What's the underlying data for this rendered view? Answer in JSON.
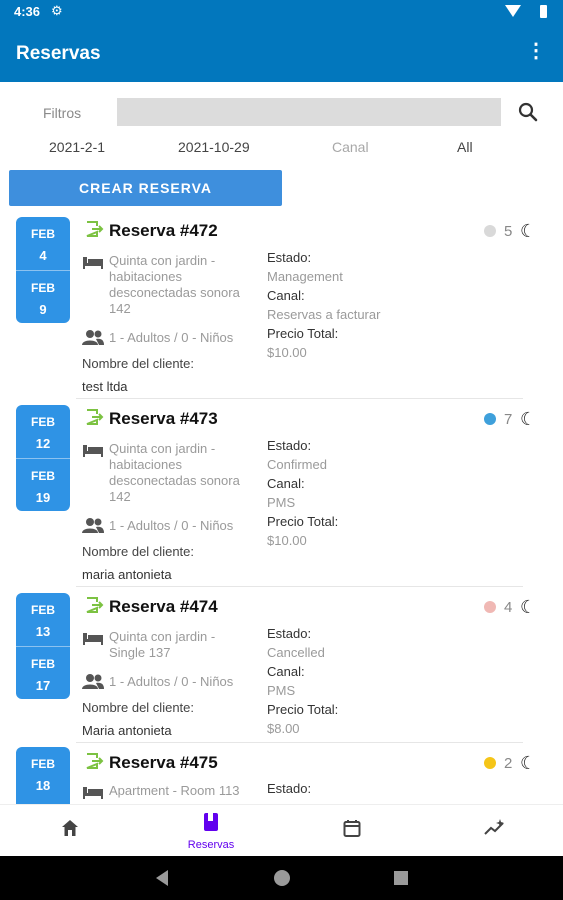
{
  "status_bar": {
    "time": "4:36"
  },
  "app_bar": {
    "title": "Reservas"
  },
  "filters": {
    "label": "Filtros",
    "search_value": "",
    "date_from": "2021-2-1",
    "date_to": "2021-10-29",
    "channel_placeholder": "Canal",
    "status": "All"
  },
  "create_button": "CREAR RESERVA",
  "labels": {
    "estado": "Estado:",
    "canal": "Canal:",
    "precio_total": "Precio Total:",
    "nombre_cliente": "Nombre del cliente:"
  },
  "reservations": [
    {
      "title": "Reserva #472",
      "checkin_month": "FEB",
      "checkin_day": "4",
      "checkout_month": "FEB",
      "checkout_day": "9",
      "room": "Quinta con jardin - habitaciones desconectadas sonora 142",
      "guests": "1 - Adultos / 0 - Niños",
      "client": "test ltda",
      "estado": "Management",
      "canal": "Reservas a facturar",
      "precio": "$10.00",
      "nights": "5",
      "status_color": "#d9d9d9"
    },
    {
      "title": "Reserva #473",
      "checkin_month": "FEB",
      "checkin_day": "12",
      "checkout_month": "FEB",
      "checkout_day": "19",
      "room": "Quinta con jardin - habitaciones desconectadas sonora 142",
      "guests": "1 - Adultos / 0 - Niños",
      "client": "maria antonieta",
      "estado": "Confirmed",
      "canal": "PMS",
      "precio": "$10.00",
      "nights": "7",
      "status_color": "#3ea0db"
    },
    {
      "title": "Reserva #474",
      "checkin_month": "FEB",
      "checkin_day": "13",
      "checkout_month": "FEB",
      "checkout_day": "17",
      "room": "Quinta con jardin - Single 137",
      "guests": "1 - Adultos / 0 - Niños",
      "client": "Maria antonieta",
      "estado": "Cancelled",
      "canal": "PMS",
      "precio": "$8.00",
      "nights": "4",
      "status_color": "#f0b8b4"
    },
    {
      "title": "Reserva #475",
      "checkin_month": "FEB",
      "checkin_day": "18",
      "room": "Apartment - Room 113",
      "nights": "2",
      "status_color": "#f5c518"
    }
  ],
  "bottom_nav": {
    "home_icon": "home-icon",
    "reservas_label": "Reservas",
    "calendar_icon": "calendar-icon",
    "stats_icon": "sparkle-chart-icon",
    "active_color": "#6200EE"
  }
}
